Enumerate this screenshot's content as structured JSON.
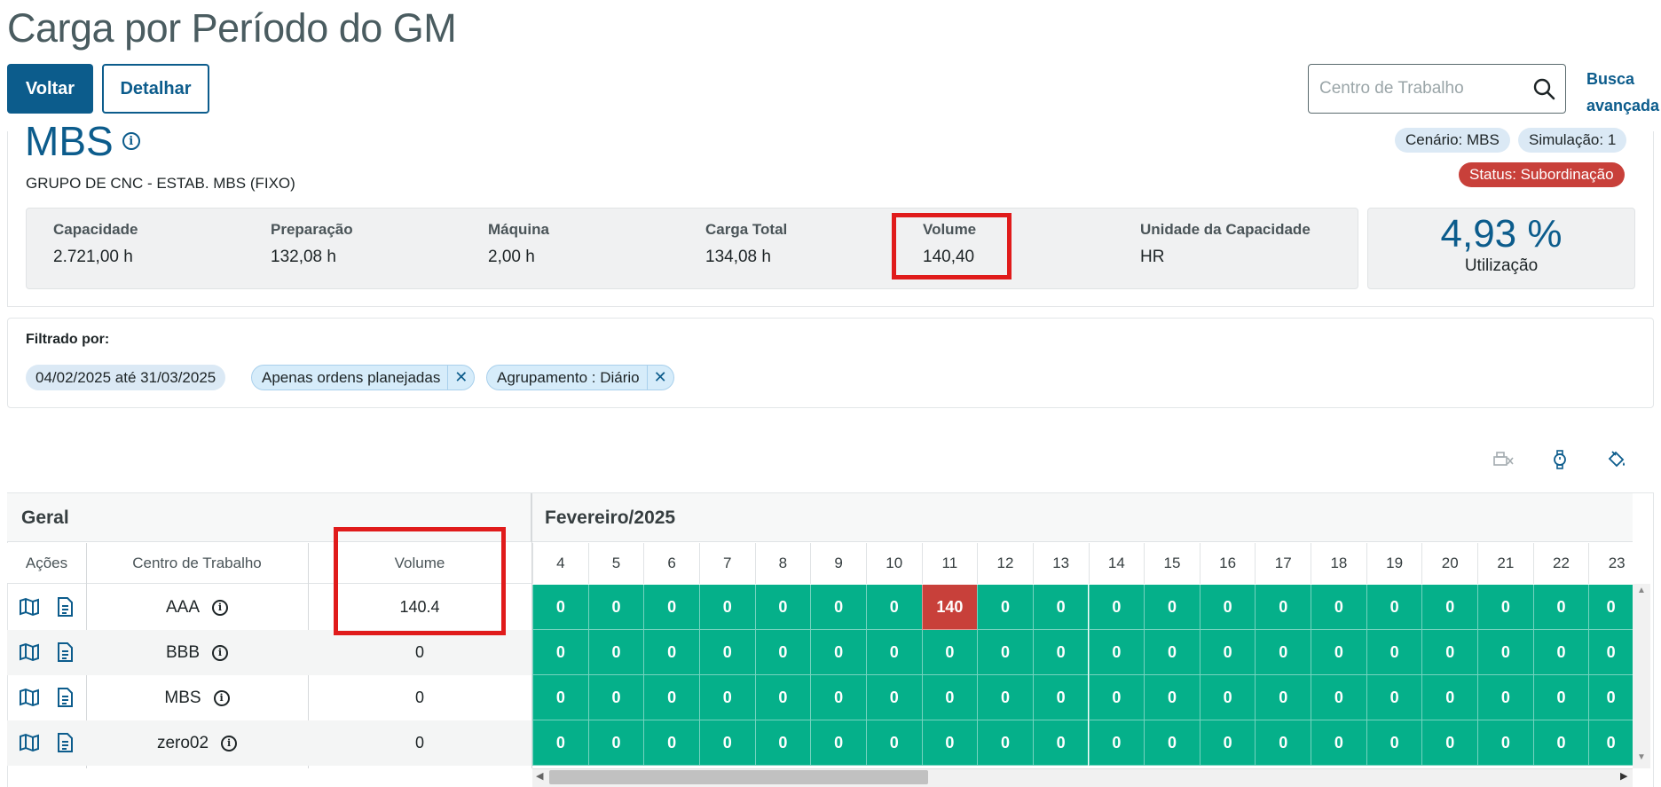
{
  "header": {
    "title": "Carga por Período do GM",
    "back_label": "Voltar",
    "detail_label": "Detalhar",
    "search_placeholder": "Centro de Trabalho",
    "advanced_search_line1": "Busca",
    "advanced_search_line2": "avançada"
  },
  "summary": {
    "name": "MBS",
    "subtitle": "GRUPO DE CNC - ESTAB. MBS (FIXO)",
    "scenario": "Cenário: MBS",
    "simulation": "Simulação: 1",
    "status": "Status: Subordinação",
    "metrics": [
      {
        "label": "Capacidade",
        "value": "2.721,00 h"
      },
      {
        "label": "Preparação",
        "value": "132,08 h"
      },
      {
        "label": "Máquina",
        "value": "2,00 h"
      },
      {
        "label": "Carga Total",
        "value": "134,08 h"
      },
      {
        "label": "Volume",
        "value": "140,40"
      },
      {
        "label": "Unidade da Capacidade",
        "value": "HR"
      }
    ],
    "utilization_value": "4,93 %",
    "utilization_label": "Utilização"
  },
  "filters": {
    "title": "Filtrado por:",
    "chips": [
      {
        "label": "04/02/2025 até 31/03/2025",
        "removable": false
      },
      {
        "label": "Apenas ordens planejadas",
        "removable": true
      },
      {
        "label": "Agrupamento : Diário",
        "removable": true
      }
    ]
  },
  "grid": {
    "general_title": "Geral",
    "month_title": "Fevereiro/2025",
    "columns": {
      "actions": "Ações",
      "work_center": "Centro de Trabalho",
      "volume": "Volume"
    },
    "days": [
      "4",
      "5",
      "6",
      "7",
      "8",
      "9",
      "10",
      "11",
      "12",
      "13",
      "14",
      "15",
      "16",
      "17",
      "18",
      "19",
      "20",
      "21",
      "22",
      "23"
    ],
    "rows": [
      {
        "center": "AAA",
        "volume": "140.4",
        "values": [
          "0",
          "0",
          "0",
          "0",
          "0",
          "0",
          "0",
          "140",
          "0",
          "0",
          "0",
          "0",
          "0",
          "0",
          "0",
          "0",
          "0",
          "0",
          "0",
          "0"
        ]
      },
      {
        "center": "BBB",
        "volume": "0",
        "values": [
          "0",
          "0",
          "0",
          "0",
          "0",
          "0",
          "0",
          "0",
          "0",
          "0",
          "0",
          "0",
          "0",
          "0",
          "0",
          "0",
          "0",
          "0",
          "0",
          "0"
        ]
      },
      {
        "center": "MBS",
        "volume": "0",
        "values": [
          "0",
          "0",
          "0",
          "0",
          "0",
          "0",
          "0",
          "0",
          "0",
          "0",
          "0",
          "0",
          "0",
          "0",
          "0",
          "0",
          "0",
          "0",
          "0",
          "0"
        ]
      },
      {
        "center": "zero02",
        "volume": "0",
        "values": [
          "0",
          "0",
          "0",
          "0",
          "0",
          "0",
          "0",
          "0",
          "0",
          "0",
          "0",
          "0",
          "0",
          "0",
          "0",
          "0",
          "0",
          "0",
          "0",
          "0"
        ]
      }
    ]
  },
  "colors": {
    "primary": "#0c5c8c",
    "ok": "#05b08a",
    "overload": "#c8403a"
  },
  "icons": [
    "search-icon",
    "info-icon",
    "close-icon",
    "map-icon",
    "document-icon",
    "printer-off-icon",
    "watch-icon",
    "paint-bucket-icon"
  ]
}
